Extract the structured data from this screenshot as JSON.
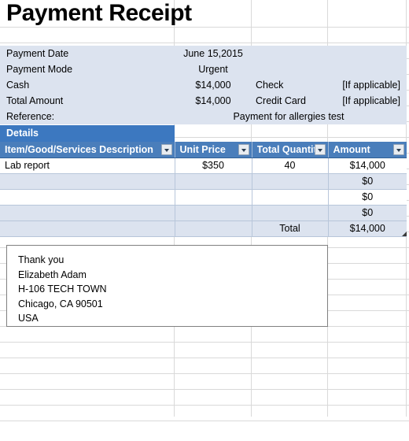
{
  "document": {
    "title": "Payment Receipt"
  },
  "info": {
    "rows": [
      {
        "label": "Payment Date",
        "value": "June 15,2015",
        "extra_label": "",
        "extra_value": ""
      },
      {
        "label": "Payment Mode",
        "value": "Urgent",
        "extra_label": "",
        "extra_value": ""
      },
      {
        "label": "Cash",
        "value": "$14,000",
        "extra_label": "Check",
        "extra_value": "[If applicable]"
      },
      {
        "label": "Total Amount",
        "value": "$14,000",
        "extra_label": "Credit Card",
        "extra_value": "[If applicable]"
      },
      {
        "label": "Reference:",
        "value": "Payment for allergies test",
        "extra_label": "",
        "extra_value": ""
      }
    ]
  },
  "details_banner": {
    "label": "Details"
  },
  "table": {
    "columns": [
      "Item/Good/Services Description",
      "Unit Price",
      "Total Quantit",
      "Amount"
    ],
    "rows": [
      {
        "description": "Lab report",
        "unit_price": "$350",
        "quantity": "40",
        "amount": "$14,000"
      },
      {
        "description": "",
        "unit_price": "",
        "quantity": "",
        "amount": "$0"
      },
      {
        "description": "",
        "unit_price": "",
        "quantity": "",
        "amount": "$0"
      },
      {
        "description": "",
        "unit_price": "",
        "quantity": "",
        "amount": "$0"
      }
    ],
    "total_row": {
      "description": "",
      "unit_price": "",
      "label": "Total",
      "amount": "$14,000"
    }
  },
  "note": {
    "lines": [
      "Thank you",
      "Elizabeth Adam",
      "H-106 TECH TOWN",
      "Chicago, CA 90501",
      "USA"
    ]
  },
  "colors": {
    "header_blue": "#4a7ebb",
    "banner_blue": "#3c78c0",
    "band_blue": "#dce3ef",
    "grid_line": "#d9d9d9",
    "table_border": "#b8c6da"
  }
}
